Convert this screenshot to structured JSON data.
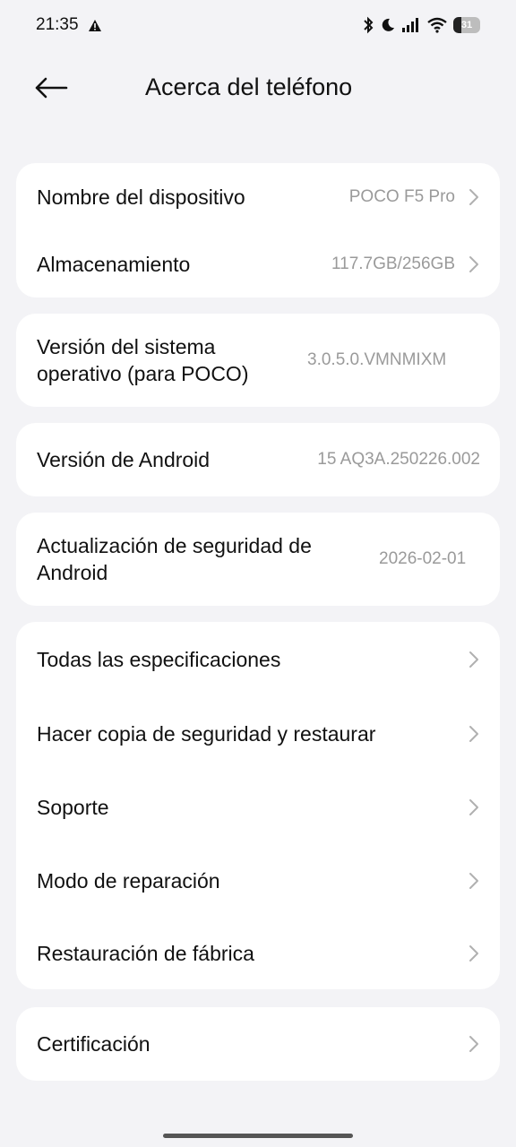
{
  "status_bar": {
    "time": "21:35",
    "battery": "31",
    "battery_fraction": 0.31,
    "icons": [
      "alert-triangle-icon",
      "bluetooth-icon",
      "moon-icon",
      "signal-icon",
      "wifi-icon",
      "battery-icon"
    ]
  },
  "header": {
    "title": "Acerca del teléfono",
    "back_icon": "arrow-left-icon"
  },
  "sections": {
    "device": {
      "name_label": "Nombre del dispositivo",
      "name_value": "POCO F5 Pro",
      "storage_label": "Almacenamiento",
      "storage_value": "117.7GB/256GB"
    },
    "os": {
      "label": "Versión del sistema operativo (para POCO)",
      "value": "3.0.5.0.VMNMIXM"
    },
    "android": {
      "label": "Versión de Android",
      "value": "15 AQ3A.250226.002"
    },
    "security": {
      "label": "Actualización de seguridad de Android",
      "value": "2026-02-01"
    },
    "more": {
      "specs": "Todas las especificaciones",
      "backup": "Hacer copia de seguridad y restaurar",
      "support": "Soporte",
      "repair": "Modo de reparación",
      "factory_reset": "Restauración de fábrica"
    },
    "certification": {
      "label": "Certificación"
    }
  },
  "colors": {
    "background": "#f3f3f6",
    "card": "#ffffff",
    "value_text": "#9a9a9a",
    "chevron": "#b0b0b0"
  }
}
